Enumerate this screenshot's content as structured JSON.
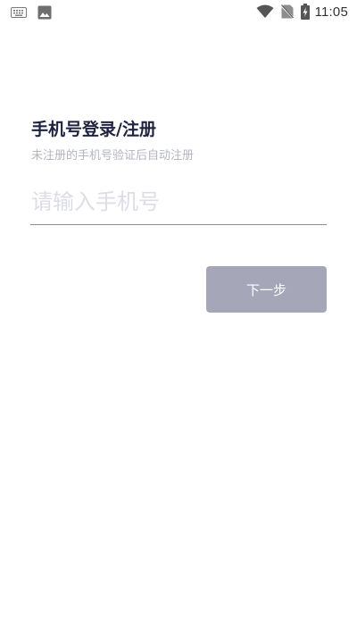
{
  "status_bar": {
    "time": "11:05",
    "icons": {
      "left": [
        "keyboard-icon",
        "image-icon"
      ],
      "right": [
        "wifi-icon",
        "no-sim-icon",
        "battery-charging-icon"
      ]
    }
  },
  "login": {
    "title": "手机号登录/注册",
    "subtitle": "未注册的手机号验证后自动注册",
    "phone_placeholder": "请输入手机号",
    "phone_value": "",
    "next_label": "下一步"
  },
  "colors": {
    "title": "#1f2340",
    "subtitle": "#b4b6c0",
    "placeholder": "#dcdde6",
    "button_bg_disabled": "#a5a7b8",
    "button_text": "#ffffff",
    "underline": "#8a8c96"
  }
}
